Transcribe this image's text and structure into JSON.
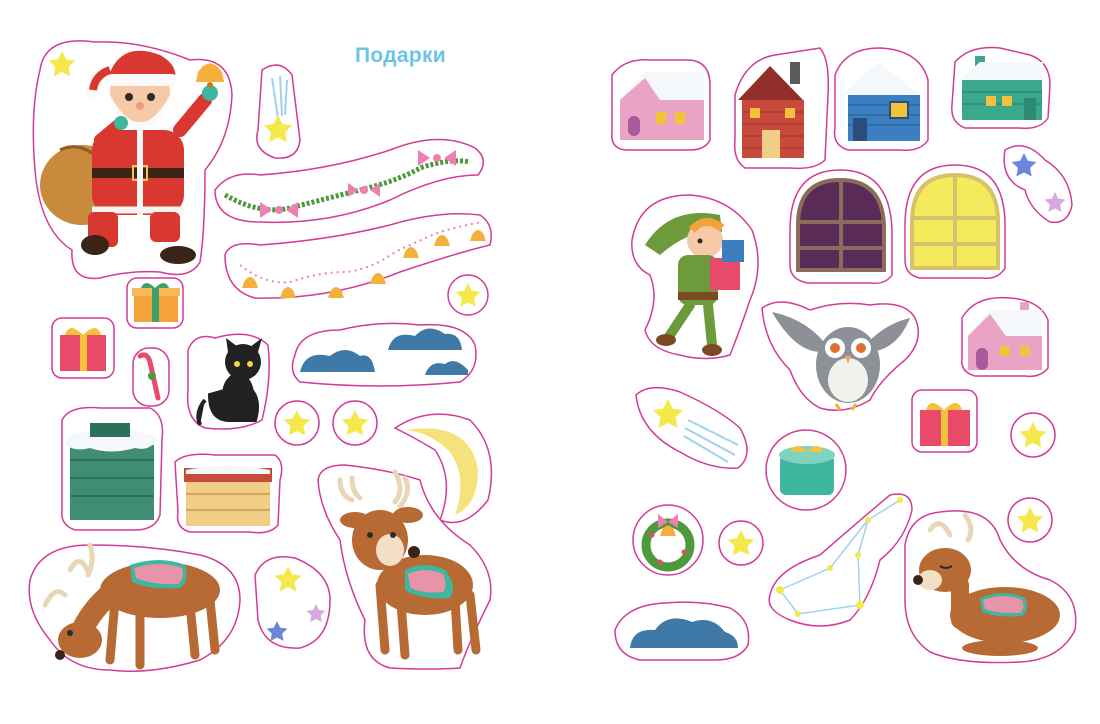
{
  "page": {
    "title": "Подарки"
  },
  "palette": {
    "outline": "#d23c96",
    "star": "#f5e84a",
    "cloud": "#3f79a8",
    "santa_red": "#d8382f",
    "reindeer": "#b86a35",
    "house_pink": "#e9a3c4",
    "house_blue": "#3c7fc0",
    "house_teal": "#3aa88d",
    "house_red": "#c84a3c",
    "chimney_green": "#3f8e74",
    "chimney_brick": "#f0ce86",
    "gift_pink": "#e94a6a",
    "gift_orange": "#f4a23a",
    "gift_teal": "#3fb6a0",
    "moon": "#f6e27a",
    "elf_green": "#6d9a3a",
    "owl_gray": "#8d9197",
    "window_purple": "#5b2b57",
    "window_yellow": "#f4ea5c"
  },
  "stickers": [
    "santa-claus-icon",
    "bell-icon",
    "shooting-star-icon",
    "garland-bows-icon",
    "garland-bells-icon",
    "gift-box-icon",
    "candy-cane-icon",
    "black-cat-icon",
    "cloud-icon",
    "star-icon",
    "crescent-moon-icon",
    "chimney-icon",
    "reindeer-icon",
    "house-icon",
    "elf-icon",
    "owl-icon",
    "window-icon",
    "wreath-icon",
    "constellation-icon"
  ]
}
